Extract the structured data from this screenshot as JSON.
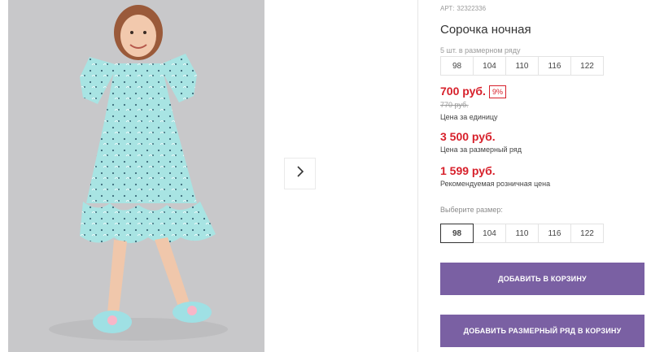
{
  "product": {
    "sku_label": "АРТ:",
    "sku": "32322336",
    "title": "Сорочка ночная",
    "pack_note": "5 шт. в размерном ряду",
    "pack_sizes": [
      "98",
      "104",
      "110",
      "116",
      "122"
    ]
  },
  "pricing": {
    "unit_price": "700 руб.",
    "discount": "9%",
    "old_price": "770 руб.",
    "unit_caption": "Цена за единицу",
    "row_price": "3 500 руб.",
    "row_caption": "Цена за размерный ряд",
    "rrp_price": "1 599 руб.",
    "rrp_caption": "Рекомендуемая розничная цена"
  },
  "size_picker": {
    "label": "Выберите размер:",
    "sizes": [
      "98",
      "104",
      "110",
      "116",
      "122"
    ],
    "selected": "98"
  },
  "actions": {
    "add_to_cart": "ДОБАВИТЬ В КОРЗИНУ",
    "add_row_to_cart": "ДОБАВИТЬ РАЗМЕРНЫЙ РЯД В КОРЗИНУ"
  },
  "colors": {
    "accent": "#7a60a3",
    "price": "#d7202b",
    "dress": "#a8e4e3"
  },
  "icons": {
    "next": "chevron-right-icon"
  }
}
